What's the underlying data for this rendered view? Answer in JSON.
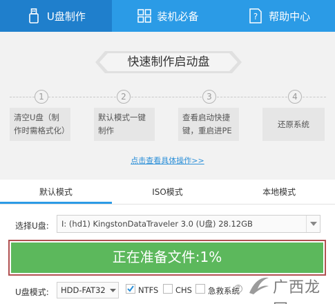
{
  "nav": {
    "items": [
      {
        "label": "U盘制作",
        "icon": "usb-drive-icon",
        "active": true
      },
      {
        "label": "装机必备",
        "icon": "grid-icon",
        "active": false
      },
      {
        "label": "帮助中心",
        "icon": "help-question-icon",
        "active": false
      }
    ]
  },
  "banner": {
    "title": "快速制作启动盘"
  },
  "steps": [
    {
      "num": "1",
      "text": "清空U盘（制作时需格式化）"
    },
    {
      "num": "2",
      "text": "默认模式一键制作"
    },
    {
      "num": "3",
      "text": "查看启动快捷键，重启进PE"
    },
    {
      "num": "4",
      "text": "还原系统"
    }
  ],
  "detail_link": "点击查看具体操作>>",
  "tabs": [
    {
      "label": "默认模式",
      "active": true
    },
    {
      "label": "ISO模式",
      "active": false
    },
    {
      "label": "本地模式",
      "active": false
    }
  ],
  "device": {
    "label": "选择U盘:",
    "value": "I: (hd1) KingstonDataTraveler 3.0 (U盘) 28.12GB"
  },
  "progress": {
    "text": "正在准备文件:1%",
    "percent": 1
  },
  "options": {
    "mode_label": "U盘模式:",
    "mode_value": "HDD-FAT32",
    "ntfs": {
      "label": "NTFS",
      "checked": true
    },
    "chs": {
      "label": "CHS",
      "checked": false
    },
    "rescue": {
      "label": "急救系统",
      "checked": false
    }
  },
  "watermark": {
    "text": "广西龙网"
  },
  "colors": {
    "accent": "#2b9be6",
    "progress": "#5cb85c",
    "highlight_border": "#b05050"
  }
}
